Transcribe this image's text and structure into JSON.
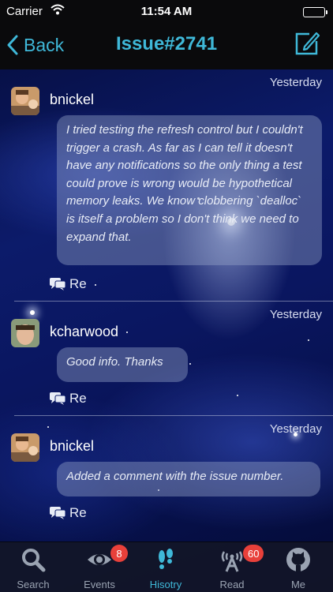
{
  "status_bar": {
    "carrier": "Carrier",
    "time": "11:54 AM"
  },
  "nav": {
    "back_label": "Back",
    "title": "Issue#2741"
  },
  "comments": [
    {
      "user": "bnickel",
      "date": "Yesterday",
      "text": "I tried testing the refresh control but I couldn't trigger a crash.  As far as I can tell it doesn't have any notifications so the only thing a test could prove is wrong would be hypothetical memory leaks.  We know clobbering `dealloc` is itself a problem so I don't think we need to expand that.",
      "reply_label": "Re"
    },
    {
      "user": "kcharwood",
      "date": "Yesterday",
      "text": "Good info. Thanks",
      "reply_label": "Re"
    },
    {
      "user": "bnickel",
      "date": "Yesterday",
      "text": "Added a comment with the issue number.",
      "reply_label": "Re"
    }
  ],
  "tabs": [
    {
      "label": "Search",
      "icon": "search-icon"
    },
    {
      "label": "Events",
      "icon": "eye-icon",
      "badge": "8"
    },
    {
      "label": "Hisotry",
      "icon": "footprints-icon",
      "active": true
    },
    {
      "label": "Read",
      "icon": "broadcast-icon",
      "badge": "60"
    },
    {
      "label": "Me",
      "icon": "github-octocat-icon"
    }
  ],
  "colors": {
    "accent": "#3fb8d8",
    "badge": "#e8403a",
    "nav_background": "#0a0a0c"
  }
}
